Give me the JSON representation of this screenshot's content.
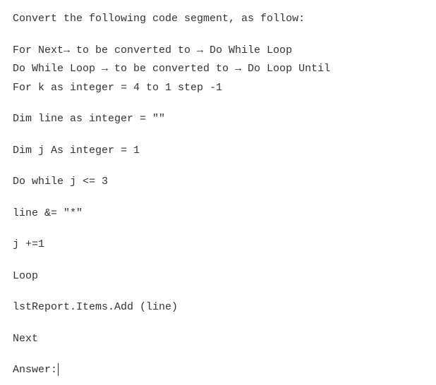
{
  "heading": "Convert the following code segment, as follow:",
  "instruction1": "For Next→ to be converted to → Do While Loop",
  "instruction2": "Do While Loop → to be converted to → Do Loop Until",
  "code1": "For k as integer = 4 to 1 step -1",
  "code2": "Dim line as integer = \"\"",
  "code3": "Dim j As integer = 1",
  "code4": "Do while j <= 3",
  "code5": "line &= \"*\"",
  "code6": "j +=1",
  "code7": "Loop",
  "code8": "lstReport.Items.Add (line)",
  "code9": "Next",
  "answer_label": "Answer:"
}
